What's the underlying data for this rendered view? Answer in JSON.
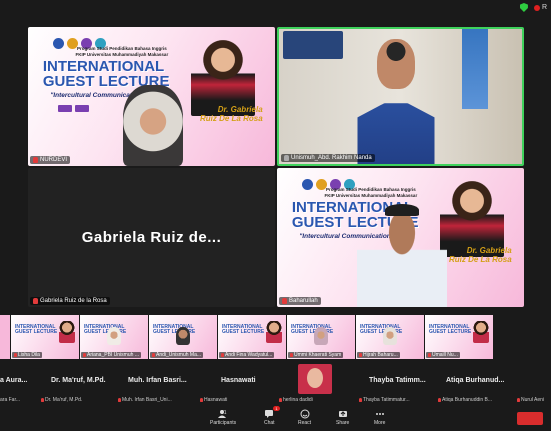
{
  "top_status": {
    "rec_label": "R"
  },
  "poster": {
    "program": "Program Studi Pendidikan Bahasa Inggris\nFKIP Universitas Muhammadiyah Makassar",
    "title_line1": "INTERNATIONAL",
    "title_line2": "GUEST LECTURE",
    "subtitle": "\"Intercultural Communication\"",
    "speaker_first": "Dr. Gabriela",
    "speaker_last": "Ruiz De La Rosa",
    "date": "Wednesday, August 16, 2023"
  },
  "tiles": {
    "nurdevi": {
      "name": "NURDEVI"
    },
    "unismuh": {
      "name": "Unismuh_Abd. Rakhim Nanda"
    },
    "gabriela": {
      "display": "Gabriela Ruiz de...",
      "name": "Gabriela Ruiz de la Rosa"
    },
    "baharullah": {
      "name": "Baharullah"
    }
  },
  "filmstrip": [
    {
      "name": "Lisha Dila"
    },
    {
      "name": "Ariana_PBI Unismuh ..."
    },
    {
      "name": "Andi_Unismuh Ma..."
    },
    {
      "name": "Andi Fina Wadyatul..."
    },
    {
      "name": "Ummi Khaerati Syam"
    },
    {
      "name": "Hijrah Baharu..."
    },
    {
      "name": "Umaill Nu..."
    }
  ],
  "participants_row": [
    {
      "title": "a Aura...",
      "sub": "ara Far..."
    },
    {
      "title": "Dr. Ma'ruf, M.Pd.",
      "sub": "Dr. Ma'ruf, M.Pd."
    },
    {
      "title": "Muh. Irfan Basri...",
      "sub": "Muh. Irfan Basri_Uni..."
    },
    {
      "title": "Hasnawati",
      "sub": "Hasnawati"
    },
    {
      "title": "",
      "sub": "herlina dadidi"
    },
    {
      "title": "Thayba Tatimm...",
      "sub": "Thayba Tatimmatur..."
    },
    {
      "title": "Atiqa Burhanud...",
      "sub": "Atiqa Burhanuddin B..."
    },
    {
      "title": "",
      "sub": "Nurul Aeni"
    }
  ],
  "toolbar": {
    "participants_label": "Participants",
    "participants_count": "51",
    "chat_label": "Chat",
    "chat_badge": "1",
    "react_label": "React",
    "share_label": "Share",
    "more_label": "More"
  }
}
